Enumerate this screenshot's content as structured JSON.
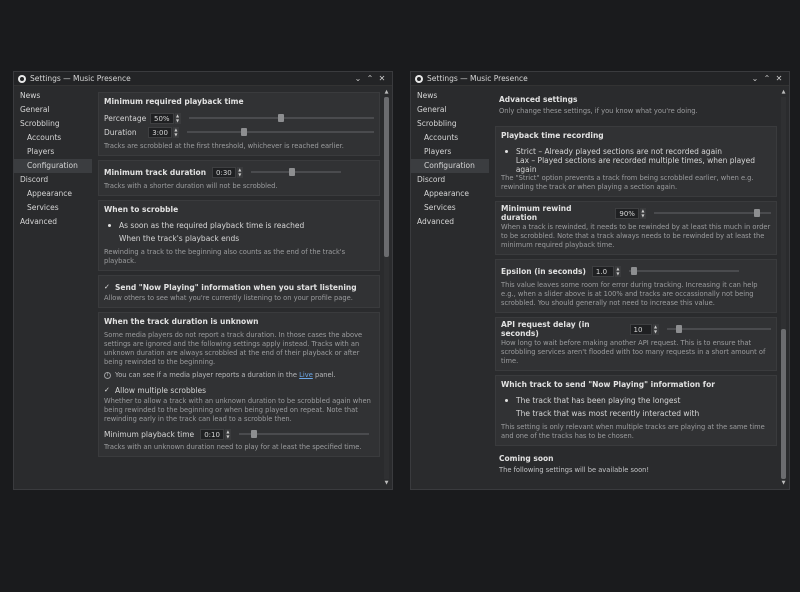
{
  "left_window": {
    "title": "Settings — Music Presence",
    "sidebar": [
      {
        "label": "News",
        "sub": false,
        "active": false
      },
      {
        "label": "General",
        "sub": false,
        "active": false
      },
      {
        "label": "Scrobbling",
        "sub": false,
        "active": false
      },
      {
        "label": "Accounts",
        "sub": true,
        "active": false
      },
      {
        "label": "Players",
        "sub": true,
        "active": false
      },
      {
        "label": "Configuration",
        "sub": true,
        "active": true
      },
      {
        "label": "Discord",
        "sub": false,
        "active": false
      },
      {
        "label": "Appearance",
        "sub": true,
        "active": false
      },
      {
        "label": "Services",
        "sub": true,
        "active": false
      },
      {
        "label": "Advanced",
        "sub": false,
        "active": false
      }
    ],
    "min_playback": {
      "title": "Minimum required playback time",
      "percentage_label": "Percentage",
      "percentage_value": "50%",
      "percentage_slider": 0.5,
      "duration_label": "Duration",
      "duration_value": "3:00",
      "duration_slider": 0.3,
      "desc": "Tracks are scrobbled at the first threshold, whichever is reached earlier."
    },
    "min_track": {
      "title": "Minimum track duration",
      "value": "0:30",
      "slider": 0.45,
      "desc": "Tracks with a shorter duration will not be scrobbled."
    },
    "when_scrobble": {
      "title": "When to scrobble",
      "option1": "As soon as the required playback time is reached",
      "option2": "When the track's playback ends",
      "desc": "Rewinding a track to the beginning also counts as the end of the track's playback."
    },
    "now_playing": {
      "title": "Send \"Now Playing\" information when you start listening",
      "desc": "Allow others to see what you're currently listening to on your profile page."
    },
    "unknown": {
      "title": "When the track duration is unknown",
      "desc": "Some media players do not report a track duration. In those cases the above settings are ignored and the following settings apply instead. Tracks with an unknown duration are always scrobbled at the end of their playback or after being rewinded to the beginning.",
      "info_text": "You can see if a media player reports a duration in the",
      "info_link": "Live",
      "info_suffix": "panel.",
      "allow_multiple": "Allow multiple scrobbles",
      "allow_desc": "Whether to allow a track with an unknown duration to be scrobbled again when being rewinded to the beginning or when being played on repeat. Note that rewinding early in the track can lead to a scrobble then.",
      "min_time_label": "Minimum playback time",
      "min_time_value": "0:10",
      "min_time_slider": 0.1,
      "min_time_desc": "Tracks with an unknown duration need to play for at least the specified time."
    },
    "scroll_fraction": 0.0
  },
  "right_window": {
    "title": "Settings — Music Presence",
    "sidebar": [
      {
        "label": "News",
        "sub": false,
        "active": false
      },
      {
        "label": "General",
        "sub": false,
        "active": false
      },
      {
        "label": "Scrobbling",
        "sub": false,
        "active": false
      },
      {
        "label": "Accounts",
        "sub": true,
        "active": false
      },
      {
        "label": "Players",
        "sub": true,
        "active": false
      },
      {
        "label": "Configuration",
        "sub": true,
        "active": true
      },
      {
        "label": "Discord",
        "sub": false,
        "active": false
      },
      {
        "label": "Appearance",
        "sub": true,
        "active": false
      },
      {
        "label": "Services",
        "sub": true,
        "active": false
      },
      {
        "label": "Advanced",
        "sub": false,
        "active": false
      }
    ],
    "advanced": {
      "title": "Advanced settings",
      "desc": "Only change these settings, if you know what you're doing."
    },
    "recording": {
      "title": "Playback time recording",
      "option1": "Strict – Already played sections are not recorded again",
      "option2": "Lax – Played sections are recorded multiple times, when played again",
      "desc": "The \"Strict\" option prevents a track from being scrobbled earlier, when e.g. rewinding the track or when playing a section again."
    },
    "rewind": {
      "title": "Minimum rewind duration",
      "value": "90%",
      "slider": 0.9,
      "desc": "When a track is rewinded, it needs to be rewinded by at least this much in order to be scrobbled. Note that a track always needs to be rewinded by at least the minimum required playback time."
    },
    "epsilon": {
      "title": "Epsilon (in seconds)",
      "value": "1.0",
      "slider": 0.02,
      "desc": "This value leaves some room for error during tracking. Increasing it can help e.g., when a slider above is at 100% and tracks are occassionally not being scrobbled. You should generally not need to increase this value."
    },
    "api_delay": {
      "title": "API request delay (in seconds)",
      "value": "10",
      "slider": 0.1,
      "desc": "How long to wait before making another API request. This is to ensure that scrobbling services aren't flooded with too many requests in a short amount of time."
    },
    "which_track": {
      "title": "Which track to send \"Now Playing\" information for",
      "option1": "The track that has been playing the longest",
      "option2": "The track that was most recently interacted with",
      "desc": "This setting is only relevant when multiple tracks are playing at the same time and one of the tracks has to be chosen."
    },
    "coming_soon": {
      "title": "Coming soon",
      "desc": "The following settings will be available soon!"
    },
    "scroll_fraction": 1.0
  }
}
